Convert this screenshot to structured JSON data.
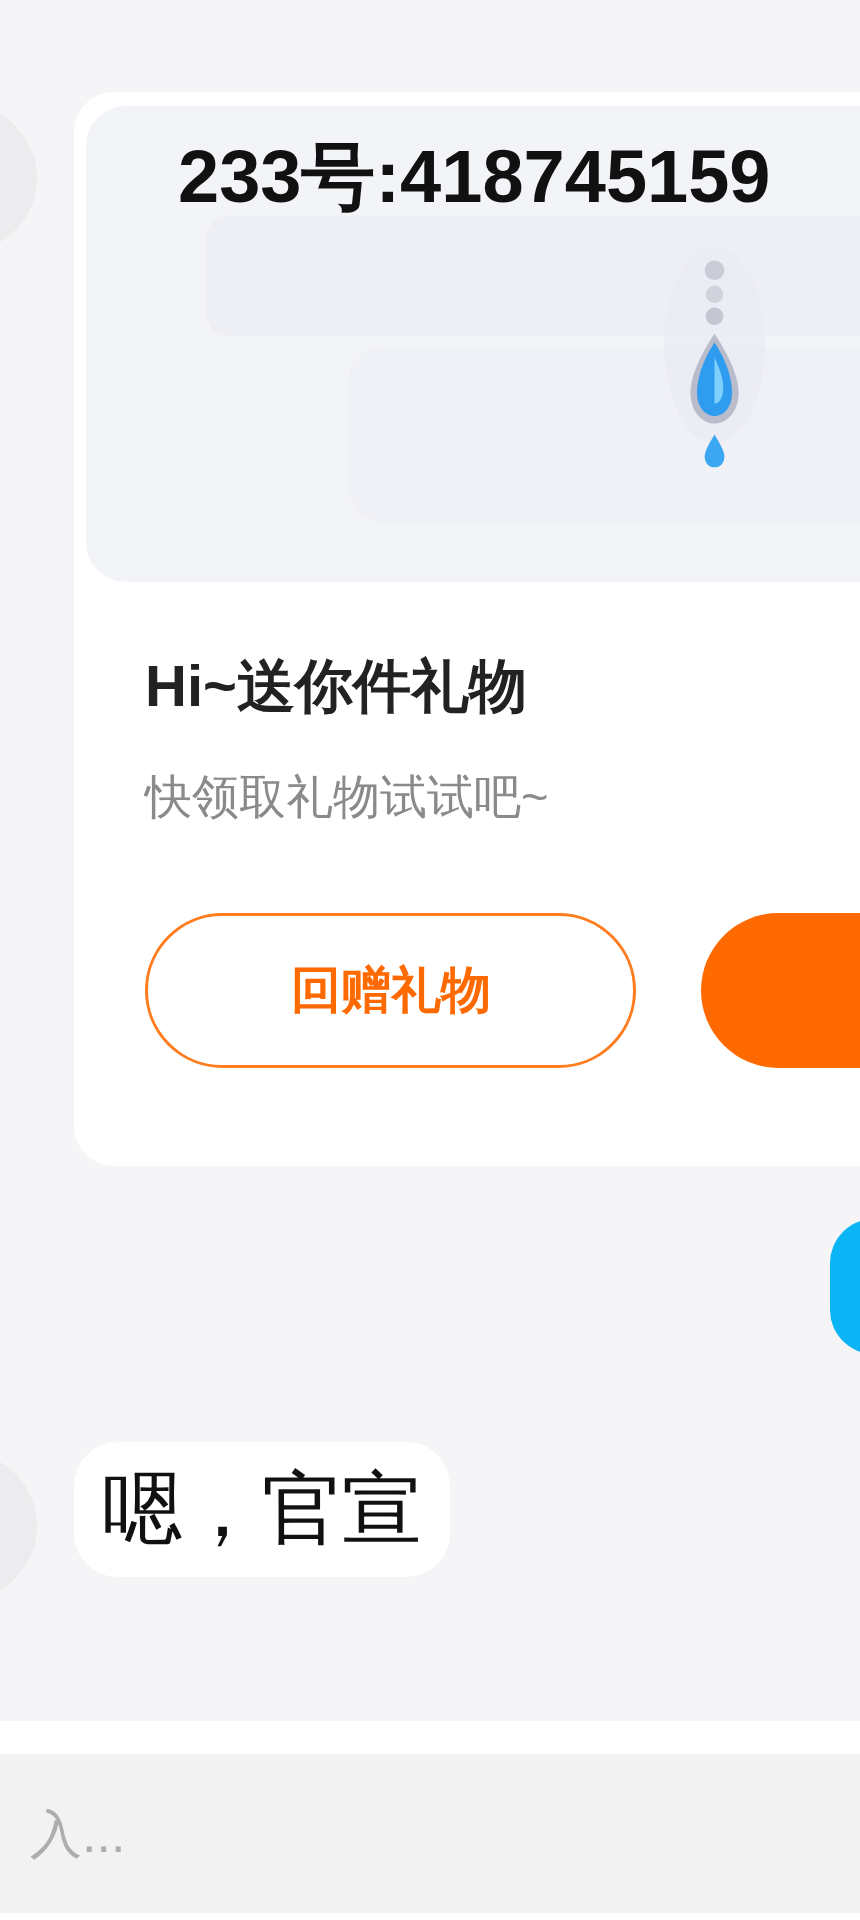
{
  "messages": [
    {
      "kind": "gift_card",
      "overlay_text": "233号:418745159",
      "image": {
        "kind": "picture"
      },
      "title": "Hi~送你件礼物",
      "subtitle": "快领取礼物试试吧~",
      "buttons": [
        {
          "kind": "outline",
          "label": "回赠礼物"
        },
        {
          "kind": "filled"
        }
      ]
    },
    {
      "kind": "outgoing_bubble"
    },
    {
      "kind": "text",
      "text": "嗯，官宣"
    }
  ],
  "input": {
    "placeholder": "入..."
  }
}
